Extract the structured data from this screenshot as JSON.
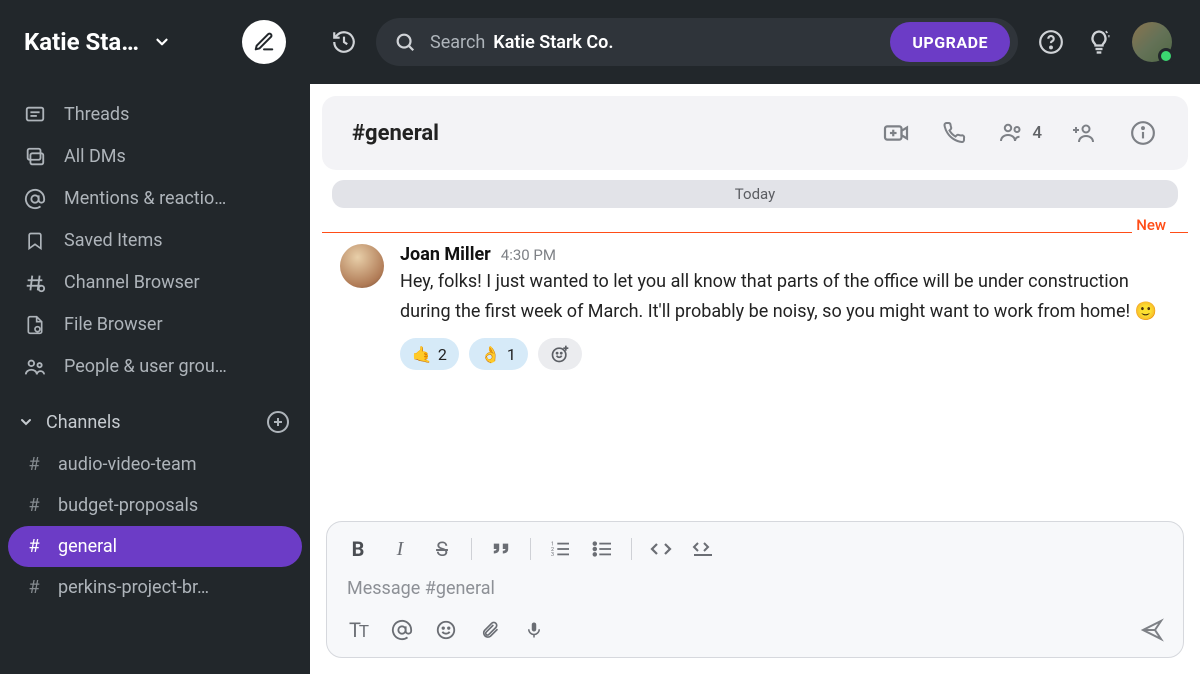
{
  "workspace": {
    "name": "Katie Sta…"
  },
  "topbar": {
    "search_prefix": "Search",
    "search_scope": "Katie Stark Co.",
    "upgrade_label": "UPGRADE"
  },
  "sidebar": {
    "nav": [
      {
        "label": "Threads",
        "icon": "threads-icon"
      },
      {
        "label": "All DMs",
        "icon": "dms-icon"
      },
      {
        "label": "Mentions & reactio…",
        "icon": "mentions-icon"
      },
      {
        "label": "Saved Items",
        "icon": "bookmark-icon"
      },
      {
        "label": "Channel Browser",
        "icon": "channel-browser-icon"
      },
      {
        "label": "File Browser",
        "icon": "file-browser-icon"
      },
      {
        "label": "People & user grou…",
        "icon": "people-icon"
      }
    ],
    "channels_title": "Channels",
    "channels": [
      {
        "name": "audio-video-team",
        "active": false
      },
      {
        "name": "budget-proposals",
        "active": false
      },
      {
        "name": "general",
        "active": true
      },
      {
        "name": "perkins-project-br…",
        "active": false
      }
    ]
  },
  "channel_header": {
    "title": "#general",
    "members_count": "4"
  },
  "messages": {
    "day_label": "Today",
    "new_label": "New",
    "items": [
      {
        "author": "Joan Miller",
        "time": "4:30 PM",
        "text": "Hey, folks! I just wanted to let you all know that parts of the office will be under construction during the first week of March. It'll probably be noisy, so you might want to work from home! 🙂",
        "reactions": [
          {
            "emoji": "🤙",
            "count": "2"
          },
          {
            "emoji": "👌",
            "count": "1"
          }
        ]
      }
    ]
  },
  "composer": {
    "placeholder": "Message #general"
  }
}
